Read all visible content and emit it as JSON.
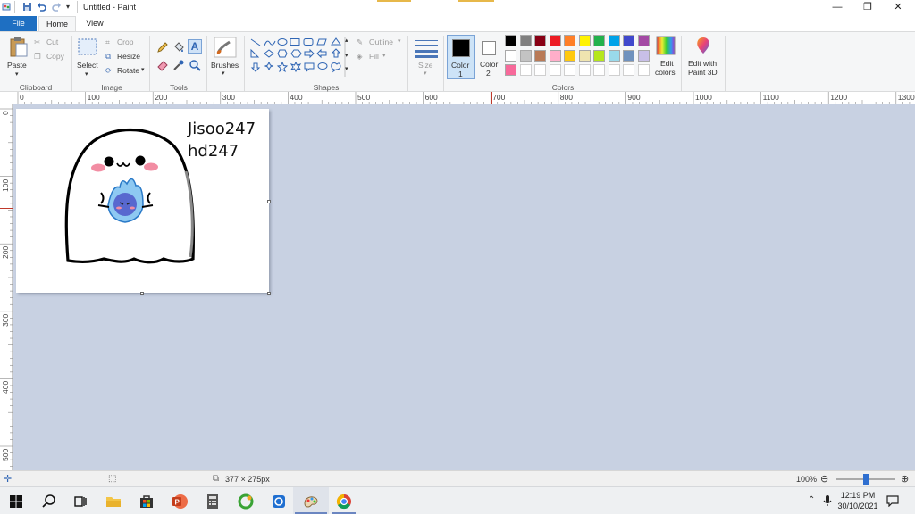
{
  "titlebar": {
    "title": "Untitled - Paint",
    "quick_access": [
      "paint-app-icon",
      "save-icon",
      "undo-icon",
      "redo-icon",
      "customize-qat-icon"
    ],
    "window_controls": [
      "minimize-icon",
      "restore-icon",
      "close-icon"
    ]
  },
  "tabs": {
    "file": "File",
    "home": "Home",
    "view": "View"
  },
  "ribbon": {
    "clipboard": {
      "label": "Clipboard",
      "paste": "Paste",
      "cut": "Cut",
      "copy": "Copy"
    },
    "image": {
      "label": "Image",
      "select": "Select",
      "crop": "Crop",
      "resize": "Resize",
      "rotate": "Rotate"
    },
    "tools": {
      "label": "Tools",
      "items": [
        "pencil-icon",
        "fill-icon",
        "text-icon",
        "eraser-icon",
        "color-picker-icon",
        "magnifier-icon"
      ]
    },
    "brushes": {
      "label": "Brushes"
    },
    "shapes": {
      "label": "Shapes",
      "outline": "Outline",
      "fill": "Fill"
    },
    "size": {
      "label": "Size"
    },
    "colors": {
      "label": "Colors",
      "color1": "Color\n1",
      "color1_a": "Color",
      "color1_b": "1",
      "color2_a": "Color",
      "color2_b": "2",
      "edit_colors_a": "Edit",
      "edit_colors_b": "colors",
      "paint3d_a": "Edit with",
      "paint3d_b": "Paint 3D",
      "palette_row1": [
        "#000000",
        "#7f7f7f",
        "#880015",
        "#ed1c24",
        "#ff7f27",
        "#fff200",
        "#22b14c",
        "#00a2e8",
        "#3f48cc",
        "#a349a4"
      ],
      "palette_row2": [
        "#ffffff",
        "#c3c3c3",
        "#b97a57",
        "#ffaec9",
        "#ffc90e",
        "#efe4b0",
        "#b5e61d",
        "#99d9ea",
        "#7092be",
        "#c8bfe7"
      ],
      "palette_row3": [
        "#f7699a",
        "",
        "",
        "",
        "",
        "",
        "",
        "",
        "",
        ""
      ],
      "color1_value": "#000000",
      "color2_value": "#ffffff"
    }
  },
  "ruler": {
    "h_labels": [
      "0",
      "100",
      "200",
      "300",
      "400",
      "500",
      "600",
      "700",
      "800",
      "900",
      "1000",
      "1100",
      "1200",
      "1300"
    ],
    "v_labels": [
      "0",
      "100",
      "200",
      "300",
      "400",
      "500"
    ]
  },
  "canvas": {
    "text_line1": "Jisoo247",
    "text_line2": "hd247"
  },
  "statusbar": {
    "dimensions": "377 × 275px",
    "zoom": "100%",
    "zoom_level_percent": 100
  },
  "taskbar": {
    "apps": [
      "start-icon",
      "search-icon",
      "task-view-icon",
      "file-explorer-icon",
      "store-icon",
      "powerpoint-icon",
      "calculator-icon",
      "app-green-icon",
      "app-blue-icon",
      "paint-icon",
      "chrome-icon"
    ],
    "time": "12:19 PM",
    "date": "30/10/2021"
  }
}
